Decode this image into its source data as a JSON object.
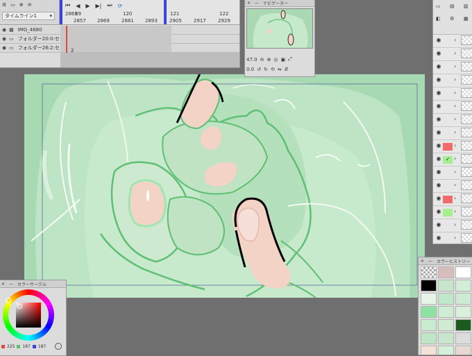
{
  "timeline": {
    "title": "タイムライン1",
    "frame_numbers_top": [
      "2865",
      "119",
      "120",
      "121",
      "122"
    ],
    "frame_numbers_bottom": [
      "2857",
      "2869",
      "2881",
      "2893",
      "2905",
      "2917",
      "2929"
    ],
    "frame_marker": "89",
    "layers": [
      {
        "name": "IMG_4680"
      },
      {
        "name": "フォルダー20:0:セ"
      },
      {
        "name": "フォルダー26:2:セ"
      }
    ],
    "frame_cell_label": "2"
  },
  "navigator": {
    "title": "ナビゲーター",
    "zoom": "47.0",
    "rotation": "0.0"
  },
  "color_circle": {
    "title": "カラーサークル",
    "r": "225",
    "g": "187",
    "b": "187",
    "current_color": "#e1bbbb"
  },
  "color_history": {
    "title": "カラーヒストリー",
    "swatches": [
      "#ffffff",
      "#d9bdbd",
      "#ffffff",
      "#000000",
      "#c8e6c9",
      "#d4edd6",
      "#e7f4e8",
      "#bfe8c8",
      "#cfead2",
      "#8ee2a4",
      "#cdeed3",
      "#d8f0dc",
      "#c9ecd0",
      "#d2ecd4",
      "#1d5a1f",
      "#bfe5c4",
      "#c7e6cb",
      "#dcdcdc",
      "#f2e2d8",
      "#d6efd9",
      "#ead8d4"
    ]
  },
  "layers": {
    "rows": [
      {
        "color": "#e7e7e7",
        "checked": false
      },
      {
        "color": "#e7e7e7",
        "checked": false
      },
      {
        "color": "#e7e7e7",
        "checked": false
      },
      {
        "color": "#e7e7e7",
        "checked": false
      },
      {
        "color": "#e7e7e7",
        "checked": false
      },
      {
        "color": "#e7e7e7",
        "checked": false
      },
      {
        "color": "#e7e7e7",
        "checked": false
      },
      {
        "color": "#e7e7e7",
        "checked": false
      },
      {
        "color": "#f26b6b",
        "checked": false
      },
      {
        "color": "#a6ef8f",
        "checked": true
      },
      {
        "color": "#e7e7e7",
        "checked": false
      },
      {
        "color": "#e7e7e7",
        "checked": false
      },
      {
        "color": "#f26b6b",
        "checked": false
      },
      {
        "color": "#a6ef8f",
        "checked": false
      },
      {
        "color": "#e7e7e7",
        "checked": false
      },
      {
        "color": "#e7e7e7",
        "checked": false
      }
    ]
  },
  "colors": {
    "canvas_bg": "#a9d8b2",
    "line_green": "#5fbf74",
    "skin": "#f2d3c6",
    "accent_blue": "#3a46d8",
    "accent_red": "#e0483a"
  }
}
